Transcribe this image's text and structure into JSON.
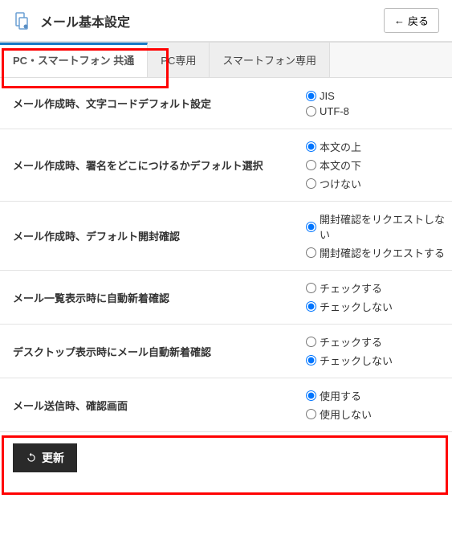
{
  "header": {
    "title": "メール基本設定",
    "backLabel": "戻る"
  },
  "tabs": [
    {
      "label": "PC・スマートフォン 共通",
      "active": true
    },
    {
      "label": "PC専用",
      "active": false
    },
    {
      "label": "スマートフォン専用",
      "active": false
    }
  ],
  "settings": [
    {
      "name": "charset",
      "label": "メール作成時、文字コードデフォルト設定",
      "options": [
        "JIS",
        "UTF-8"
      ],
      "selected": 0
    },
    {
      "name": "signature-position",
      "label": "メール作成時、署名をどこにつけるかデフォルト選択",
      "options": [
        "本文の上",
        "本文の下",
        "つけない"
      ],
      "selected": 0
    },
    {
      "name": "read-receipt",
      "label": "メール作成時、デフォルト開封確認",
      "options": [
        "開封確認をリクエストしない",
        "開封確認をリクエストする"
      ],
      "selected": 0
    },
    {
      "name": "list-auto-check",
      "label": "メール一覧表示時に自動新着確認",
      "options": [
        "チェックする",
        "チェックしない"
      ],
      "selected": 1
    },
    {
      "name": "desktop-auto-check",
      "label": "デスクトップ表示時にメール自動新着確認",
      "options": [
        "チェックする",
        "チェックしない"
      ],
      "selected": 1
    },
    {
      "name": "send-confirm",
      "label": "メール送信時、確認画面",
      "options": [
        "使用する",
        "使用しない"
      ],
      "selected": 0
    }
  ],
  "buttons": {
    "update": "更新"
  }
}
